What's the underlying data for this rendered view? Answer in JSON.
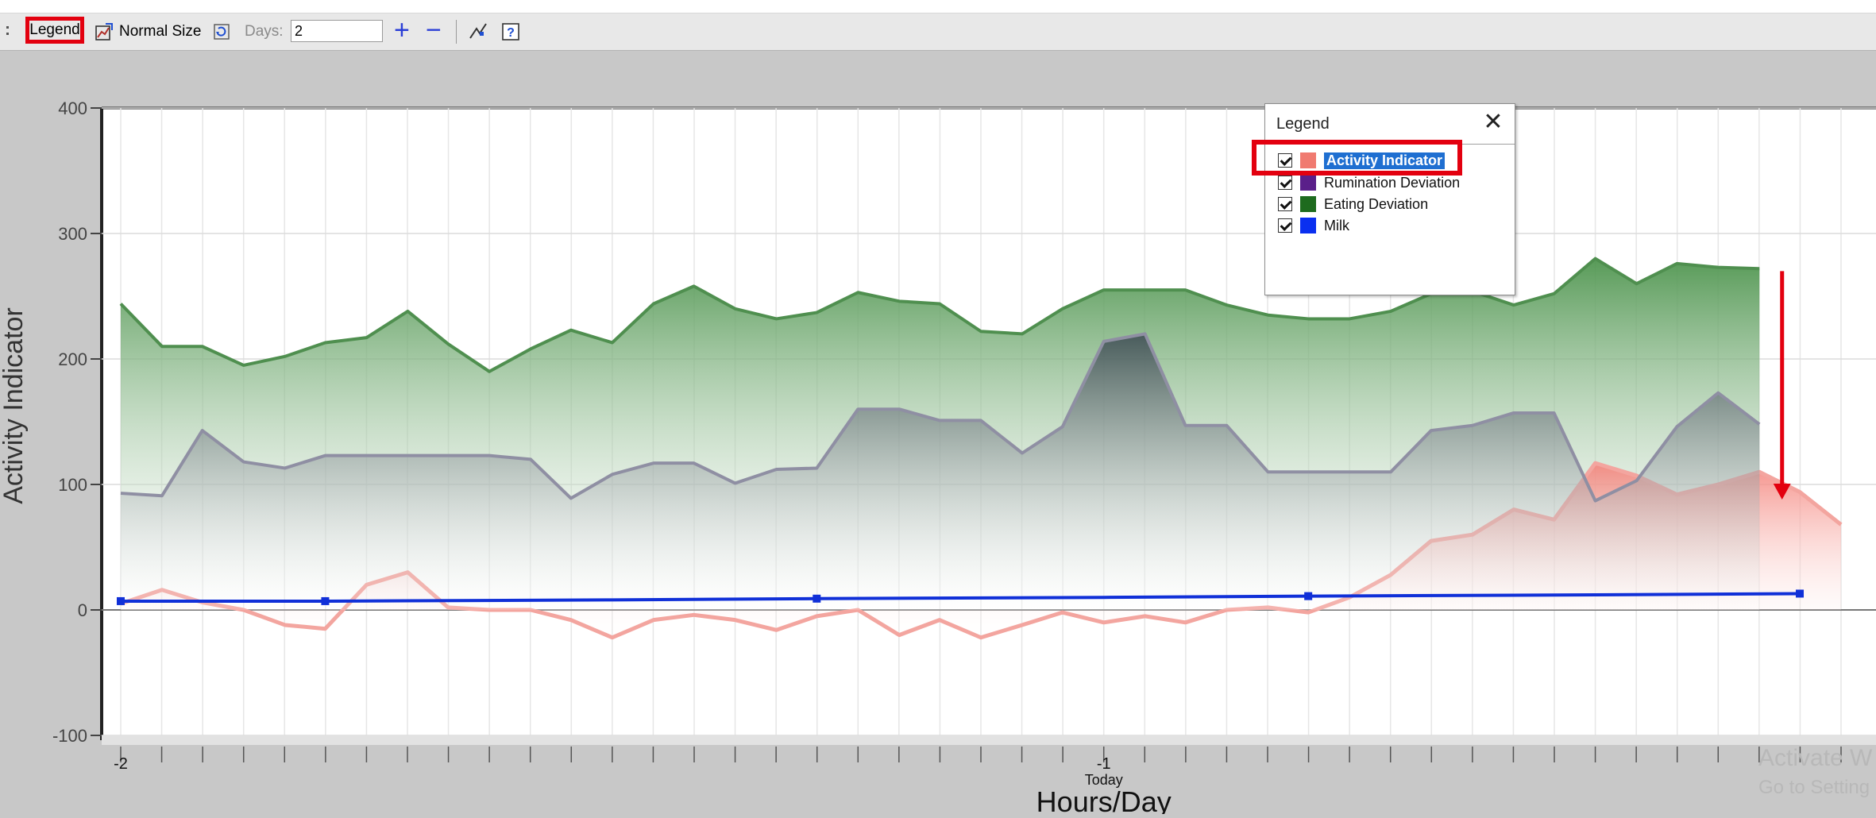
{
  "toolbar": {
    "legend_label": "Legend",
    "normal_size_label": "Normal Size",
    "days_label": "Days:",
    "days_value": "2",
    "plus_label": "+",
    "minus_label": "−"
  },
  "legend_panel": {
    "title": "Legend",
    "close_label": "✕",
    "items": [
      {
        "label": "Activity Indicator",
        "color": "#f07a70",
        "checked": true,
        "selected": true
      },
      {
        "label": "Rumination Deviation",
        "color": "#5a1f8a",
        "checked": true
      },
      {
        "label": "Eating Deviation",
        "color": "#1e6b1e",
        "checked": true
      },
      {
        "label": "Milk",
        "color": "#0a2ff0",
        "checked": true
      }
    ]
  },
  "watermark": {
    "line1": "Activate W",
    "line2": "Go to Setting"
  },
  "chart_data": {
    "type": "area",
    "ylabel": "Activity Indicator",
    "xlabel": "Hours/Day",
    "ylim": [
      -100,
      400
    ],
    "yticks": [
      -100,
      0,
      100,
      200,
      300,
      400
    ],
    "xlim": [
      -2,
      -0.25
    ],
    "xtick_labels": [
      {
        "x": -2,
        "label": "-2"
      },
      {
        "x": -1,
        "label": "-1",
        "sublabel": "Today"
      }
    ],
    "colors": {
      "eating": "#3a8a3a",
      "rumination": "#8f8fa3",
      "activity": "#f08a84",
      "milk": "#1030d8"
    },
    "series": [
      {
        "name": "Eating Deviation",
        "x": [
          -2.0,
          -1.958,
          -1.917,
          -1.875,
          -1.833,
          -1.792,
          -1.75,
          -1.708,
          -1.667,
          -1.625,
          -1.583,
          -1.542,
          -1.5,
          -1.458,
          -1.417,
          -1.375,
          -1.333,
          -1.292,
          -1.25,
          -1.208,
          -1.167,
          -1.125,
          -1.083,
          -1.042,
          -1.0,
          -0.958,
          -0.917,
          -0.875,
          -0.833,
          -0.792,
          -0.75,
          -0.708,
          -0.667,
          -0.625,
          -0.583,
          -0.542,
          -0.5,
          -0.458,
          -0.417,
          -0.375,
          -0.333
        ],
        "values": [
          244,
          210,
          210,
          195,
          202,
          213,
          217,
          238,
          212,
          190,
          208,
          223,
          213,
          244,
          258,
          240,
          232,
          237,
          253,
          246,
          244,
          222,
          220,
          240,
          255,
          255,
          255,
          243,
          235,
          232,
          232,
          238,
          252,
          254,
          243,
          252,
          280,
          260,
          276,
          273,
          272
        ]
      },
      {
        "name": "Rumination Deviation",
        "x": [
          -2.0,
          -1.958,
          -1.917,
          -1.875,
          -1.833,
          -1.792,
          -1.75,
          -1.708,
          -1.667,
          -1.625,
          -1.583,
          -1.542,
          -1.5,
          -1.458,
          -1.417,
          -1.375,
          -1.333,
          -1.292,
          -1.25,
          -1.208,
          -1.167,
          -1.125,
          -1.083,
          -1.042,
          -1.0,
          -0.958,
          -0.917,
          -0.875,
          -0.833,
          -0.792,
          -0.75,
          -0.708,
          -0.667,
          -0.625,
          -0.583,
          -0.542,
          -0.5,
          -0.458,
          -0.417,
          -0.375,
          -0.333
        ],
        "values": [
          93,
          91,
          143,
          118,
          113,
          123,
          123,
          123,
          123,
          123,
          120,
          89,
          108,
          117,
          117,
          101,
          112,
          113,
          160,
          160,
          151,
          151,
          125,
          146,
          214,
          220,
          147,
          147,
          110,
          110,
          110,
          110,
          143,
          147,
          157,
          157,
          87,
          103,
          146,
          173,
          148
        ]
      },
      {
        "name": "Activity Indicator",
        "x": [
          -2.0,
          -1.958,
          -1.917,
          -1.875,
          -1.833,
          -1.792,
          -1.75,
          -1.708,
          -1.667,
          -1.625,
          -1.583,
          -1.542,
          -1.5,
          -1.458,
          -1.417,
          -1.375,
          -1.333,
          -1.292,
          -1.25,
          -1.208,
          -1.167,
          -1.125,
          -1.083,
          -1.042,
          -1.0,
          -0.958,
          -0.917,
          -0.875,
          -0.833,
          -0.792,
          -0.75,
          -0.708,
          -0.667,
          -0.625,
          -0.583,
          -0.542,
          -0.5,
          -0.458,
          -0.417,
          -0.375,
          -0.333,
          -0.292,
          -0.25
        ],
        "values": [
          5,
          16,
          6,
          0,
          -12,
          -15,
          20,
          30,
          2,
          0,
          0,
          -8,
          -22,
          -8,
          -4,
          -8,
          -16,
          -5,
          0,
          -20,
          -8,
          -22,
          -12,
          -2,
          -10,
          -5,
          -10,
          0,
          2,
          -2,
          10,
          28,
          55,
          60,
          80,
          72,
          117,
          107,
          92,
          100,
          110,
          94,
          68
        ]
      },
      {
        "name": "Milk",
        "x": [
          -2.0,
          -1.792,
          -1.5,
          -1.292,
          -1.0,
          -0.792,
          -0.5,
          -0.292
        ],
        "values": [
          7,
          7,
          8,
          9,
          10,
          11,
          12,
          13
        ],
        "markers_at": [
          -2.0,
          -1.792,
          -1.292,
          -0.792,
          -0.292
        ]
      }
    ],
    "annotations": [
      {
        "type": "arrow",
        "color": "#e3000f",
        "direction": "down",
        "x": -0.31,
        "y_from": 270,
        "y_to": 88
      }
    ],
    "grid": true
  }
}
